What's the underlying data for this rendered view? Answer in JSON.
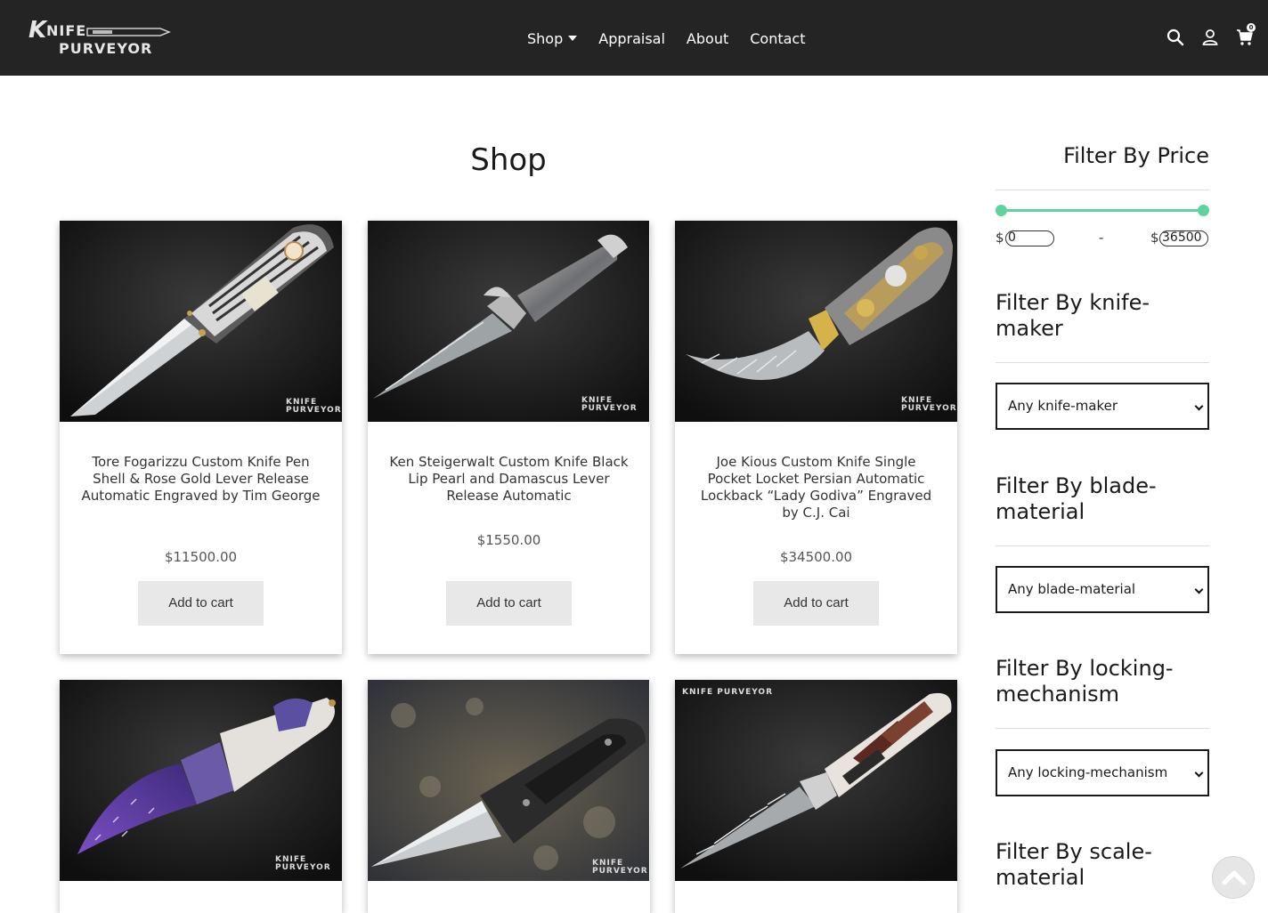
{
  "header": {
    "logo_text": "KNIFE PURVEYOR",
    "nav": [
      {
        "label": "Shop",
        "has_dropdown": true
      },
      {
        "label": "Appraisal"
      },
      {
        "label": "About"
      },
      {
        "label": "Contact"
      }
    ],
    "icons": [
      "search-icon",
      "user-icon",
      "cart-icon"
    ],
    "cart_count": "0"
  },
  "main": {
    "title": "Shop",
    "watermark": "KNIFE PURVEYOR",
    "products": [
      {
        "name": "Tore Fogarizzu Custom Knife Pen Shell & Rose Gold Lever Release Automatic Engraved by Tim George",
        "price": "$11500.00",
        "button": "Add to cart"
      },
      {
        "name": "Ken Steigerwalt Custom Knife Black Lip Pearl and Damascus Lever Release Automatic",
        "price": "$1550.00",
        "button": "Add to cart"
      },
      {
        "name": "Joe Kious Custom Knife Single Pocket Locket Persian Automatic Lockback “Lady Godiva” Engraved by C.J. Cai",
        "price": "$34500.00",
        "button": "Add to cart"
      },
      {
        "name": "",
        "price": "",
        "button": ""
      },
      {
        "name": "",
        "price": "",
        "button": ""
      },
      {
        "name": "",
        "price": "",
        "button": ""
      }
    ]
  },
  "sidebar": {
    "price_title": "Filter By Price",
    "currency": "$",
    "min_value": "0",
    "max_value": "36500",
    "range_separator": "-",
    "slider_color": "#5dd39e",
    "filters": [
      {
        "title": "Filter By knife-maker",
        "select": "Any knife-maker"
      },
      {
        "title": "Filter By blade-material",
        "select": "Any blade-material"
      },
      {
        "title": "Filter By locking-mechanism",
        "select": "Any locking-mechanism"
      },
      {
        "title": "Filter By scale-material",
        "select": ""
      }
    ]
  }
}
